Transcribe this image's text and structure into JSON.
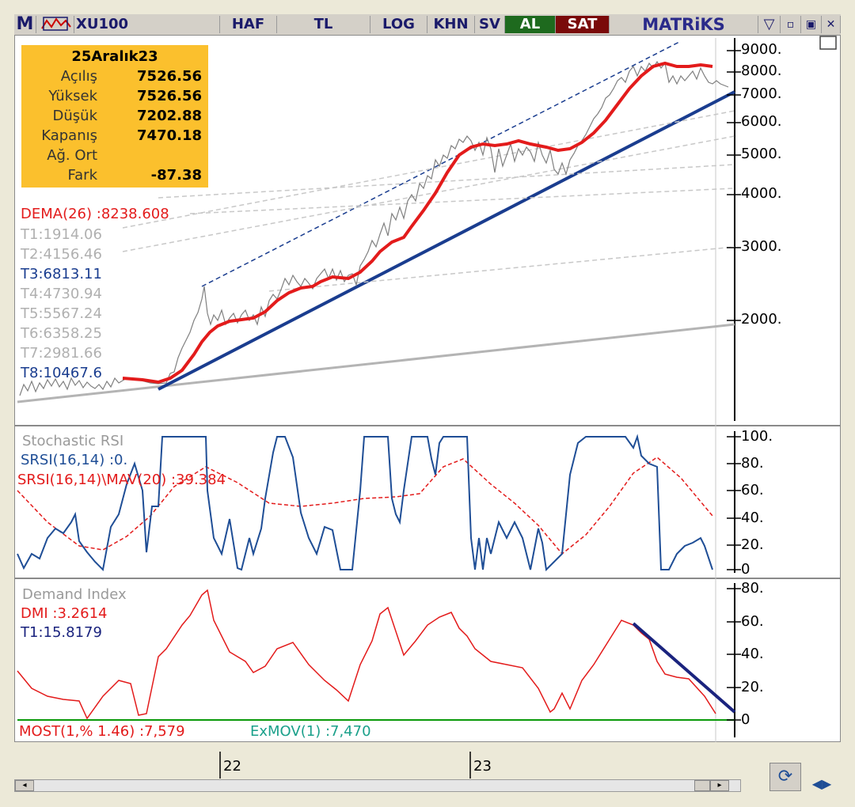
{
  "toolbar": {
    "logo": "M",
    "symbol": "XU100",
    "buttons": [
      "HAF",
      "TL",
      "LOG",
      "KHN",
      "SV"
    ],
    "buy": "AL",
    "sell": "SAT",
    "brand": "MATRiKS"
  },
  "infobox": {
    "title": "25Aralık23",
    "rows": [
      {
        "label": "Açılış",
        "value": "7526.56"
      },
      {
        "label": "Yüksek",
        "value": "7526.56"
      },
      {
        "label": "Düşük",
        "value": "7202.88"
      },
      {
        "label": "Kapanış",
        "value": "7470.18"
      },
      {
        "label": "Ağ. Ort",
        "value": ""
      },
      {
        "label": "Fark",
        "value": "-87.38"
      }
    ]
  },
  "price_panel": {
    "dema": "DEMA(26)     :8238.608",
    "trend_lines": [
      "T1:1914.06",
      "T2:4156.46",
      "T3:6813.11",
      "T4:4730.94",
      "T5:5567.24",
      "T6:6358.25",
      "T7:2981.66",
      "T8:10467.6"
    ],
    "y_ticks": [
      "9000.",
      "8000.",
      "7000.",
      "6000.",
      "5000.",
      "4000.",
      "3000.",
      "2000."
    ]
  },
  "stoch_panel": {
    "title": "Stochastic RSI",
    "srsi": "SRSI(16,14)   :0.",
    "mav": "SRSI(16,14)\\MAV(20)      :39.384",
    "y_ticks": [
      "100.",
      "80.",
      "60.",
      "40.",
      "20.",
      "0"
    ]
  },
  "demand_panel": {
    "title": "Demand Index",
    "dmi": "DMI        :3.2614",
    "t1": "T1:15.8179",
    "most": "MOST(1,% 1.46) :7,579",
    "exmov": "ExMOV(1)      :7,470",
    "y_ticks": [
      "80.",
      "60.",
      "40.",
      "20.",
      "0"
    ]
  },
  "time_axis": {
    "labels": [
      "22",
      "23"
    ]
  },
  "colors": {
    "dema": "#e31b1b",
    "trend": "#1a3d8f",
    "price": "#808080",
    "most": "#0a9a0a",
    "info_bg": "#fbc02d"
  },
  "chart_data": [
    {
      "type": "line",
      "title": "XU100",
      "y_scale": "log",
      "ylim": [
        1500,
        9500
      ],
      "x_labels": [
        "22",
        "23"
      ],
      "series": [
        {
          "name": "DEMA(26)",
          "values": [
            1580,
            1560,
            1900,
            2150,
            2300,
            2700,
            2650,
            3200,
            4300,
            5300,
            5400,
            5300,
            5150,
            6400,
            8100,
            8238.608
          ]
        }
      ]
    },
    {
      "type": "line",
      "title": "Stochastic RSI",
      "ylim": [
        0,
        100
      ],
      "series": [
        {
          "name": "SRSI(16,14)",
          "values": [
            10,
            25,
            15,
            100,
            0,
            100,
            70,
            0,
            100,
            40,
            0,
            100,
            100,
            55,
            100,
            0,
            30,
            0,
            30,
            0,
            100,
            100,
            0,
            20,
            0
          ]
        },
        {
          "name": "SRSI(16,14)\\MAV(20)",
          "values": [
            60,
            35,
            15,
            45,
            75,
            50,
            48,
            50,
            55,
            60,
            85,
            60,
            25,
            10,
            55,
            85,
            60,
            39.384
          ]
        }
      ]
    },
    {
      "type": "line",
      "title": "Demand Index",
      "ylim": [
        0,
        80
      ],
      "series": [
        {
          "name": "DMI",
          "values": [
            30,
            15,
            0,
            25,
            0,
            30,
            80,
            55,
            30,
            40,
            10,
            60,
            40,
            60,
            40,
            35,
            5,
            60,
            45,
            20,
            3.2614
          ]
        }
      ]
    }
  ]
}
